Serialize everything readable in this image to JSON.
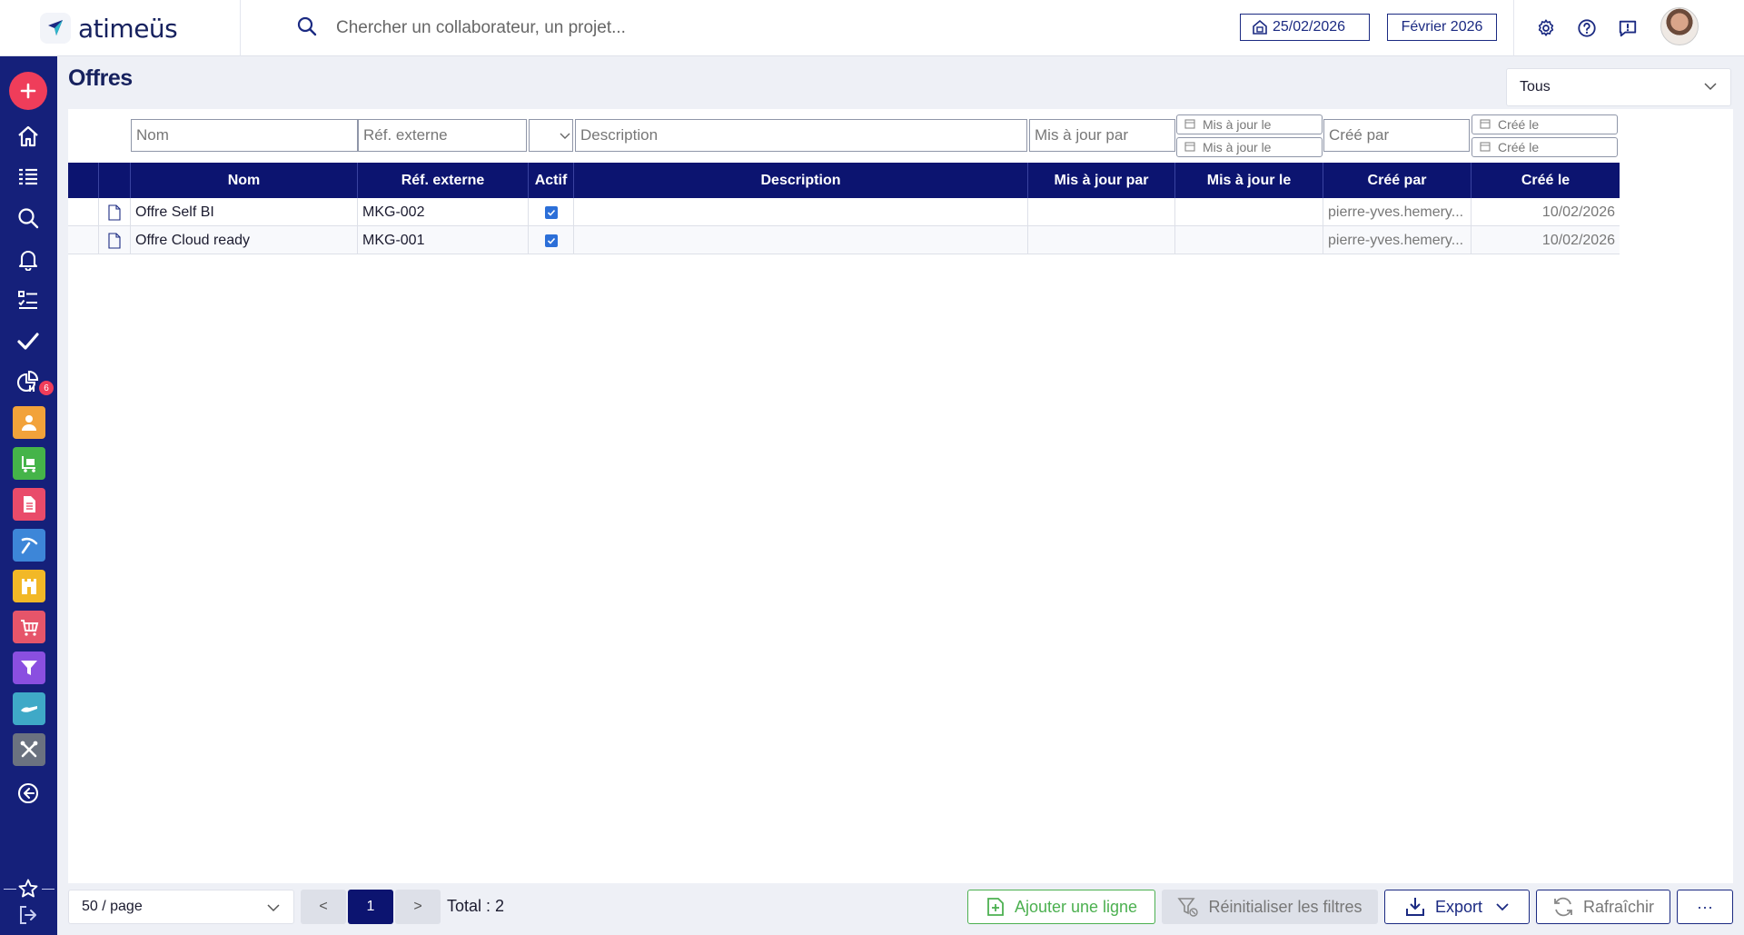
{
  "header": {
    "logo_text": "atimeüs",
    "search_placeholder": "Chercher un collaborateur, un projet...",
    "date": "25/02/2026",
    "period": "Février 2026"
  },
  "sidebar": {
    "todo_badge": "6",
    "tile_colors": [
      "#f2a23a",
      "#45b449",
      "#e94b6a",
      "#3d86d8",
      "#f2b827",
      "#e6556a",
      "#8a4fe0",
      "#3fa9c7",
      "#6b7280"
    ]
  },
  "page": {
    "title": "Offres",
    "scope_select": "Tous"
  },
  "filters": {
    "nom": "Nom",
    "ref": "Réf. externe",
    "description": "Description",
    "maj_par": "Mis à jour par",
    "maj_le_from": "Mis à jour le",
    "maj_le_to": "Mis à jour le",
    "cree_par": "Créé par",
    "cree_le_from": "Créé le",
    "cree_le_to": "Créé le"
  },
  "table": {
    "columns": [
      "Nom",
      "Réf. externe",
      "Actif",
      "Description",
      "Mis à jour par",
      "Mis à jour le",
      "Créé par",
      "Créé le"
    ],
    "rows": [
      {
        "nom": "Offre Self BI",
        "ref": "MKG-002",
        "actif": true,
        "description": "",
        "maj_par": "",
        "maj_le": "",
        "cree_par": "pierre-yves.hemery...",
        "cree_le": "10/02/2026"
      },
      {
        "nom": "Offre Cloud ready",
        "ref": "MKG-001",
        "actif": true,
        "description": "",
        "maj_par": "",
        "maj_le": "",
        "cree_par": "pierre-yves.hemery...",
        "cree_le": "10/02/2026"
      }
    ]
  },
  "footer": {
    "per_page": "50 / page",
    "prev": "<",
    "current_page": "1",
    "next": ">",
    "total": "Total : 2",
    "add_row": "Ajouter une ligne",
    "reset_filters": "Réinitialiser les filtres",
    "export": "Export",
    "refresh": "Rafraîchir",
    "more": "···"
  }
}
